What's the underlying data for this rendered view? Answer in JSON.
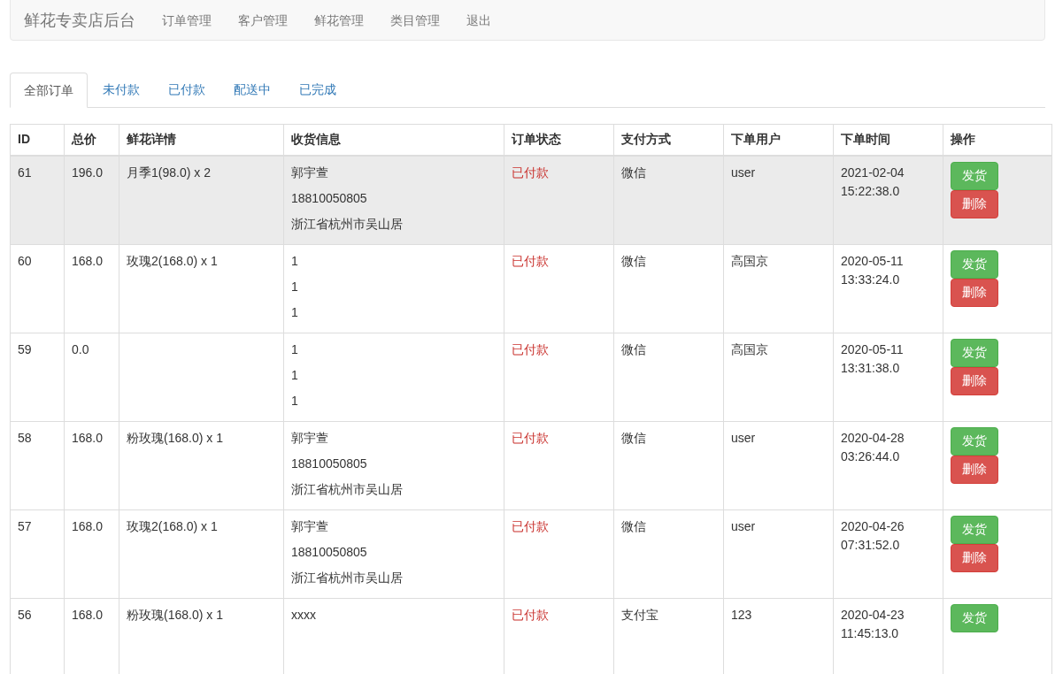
{
  "navbar": {
    "brand": "鲜花专卖店后台",
    "links": [
      "订单管理",
      "客户管理",
      "鲜花管理",
      "类目管理",
      "退出"
    ]
  },
  "tabs": [
    {
      "label": "全部订单",
      "selected": true
    },
    {
      "label": "未付款",
      "selected": false
    },
    {
      "label": "已付款",
      "selected": false
    },
    {
      "label": "配送中",
      "selected": false
    },
    {
      "label": "已完成",
      "selected": false
    }
  ],
  "table": {
    "columns": [
      "ID",
      "总价",
      "鲜花详情",
      "收货信息",
      "订单状态",
      "支付方式",
      "下单用户",
      "下单时间",
      "操作"
    ],
    "rows": [
      {
        "highlighted": true,
        "id": "61",
        "total": "196.0",
        "flowers": "月季1(98.0) x 2",
        "shipping": [
          "郭宇萱",
          "18810050805",
          "浙江省杭州市吴山居"
        ],
        "status": "已付款",
        "payment": "微信",
        "user": "user",
        "time": [
          "2021-02-04",
          "15:22:38.0"
        ],
        "actions": [
          "发货",
          "删除"
        ]
      },
      {
        "highlighted": false,
        "id": "60",
        "total": "168.0",
        "flowers": "玫瑰2(168.0) x 1",
        "shipping": [
          "1",
          "1",
          "1"
        ],
        "status": "已付款",
        "payment": "微信",
        "user": "高国京",
        "time": [
          "2020-05-11",
          "13:33:24.0"
        ],
        "actions": [
          "发货",
          "删除"
        ]
      },
      {
        "highlighted": false,
        "id": "59",
        "total": "0.0",
        "shipping": [
          "1",
          "1",
          "1"
        ],
        "status": "已付款",
        "payment": "微信",
        "user": "高国京",
        "time": [
          "2020-05-11",
          "13:31:38.0"
        ],
        "actions": [
          "发货",
          "删除"
        ]
      },
      {
        "highlighted": false,
        "id": "58",
        "total": "168.0",
        "flowers": "粉玫瑰(168.0) x 1",
        "shipping": [
          "郭宇萱",
          "18810050805",
          "浙江省杭州市吴山居"
        ],
        "status": "已付款",
        "payment": "微信",
        "user": "user",
        "time": [
          "2020-04-28",
          "03:26:44.0"
        ],
        "actions": [
          "发货",
          "删除"
        ]
      },
      {
        "highlighted": false,
        "id": "57",
        "total": "168.0",
        "flowers": "玫瑰2(168.0) x 1",
        "shipping": [
          "郭宇萱",
          "18810050805",
          "浙江省杭州市吴山居"
        ],
        "status": "已付款",
        "payment": "微信",
        "user": "user",
        "time": [
          "2020-04-26",
          "07:31:52.0"
        ],
        "actions": [
          "发货",
          "删除"
        ]
      },
      {
        "highlighted": false,
        "id": "56",
        "total": "168.0",
        "flowers": "粉玫瑰(168.0) x 1",
        "shipping": [
          "xxxx"
        ],
        "status": "已付款",
        "payment": "支付宝",
        "user": "123",
        "time": [
          "2020-04-23",
          "11:45:13.0"
        ],
        "actions": [
          "发货"
        ]
      }
    ]
  }
}
